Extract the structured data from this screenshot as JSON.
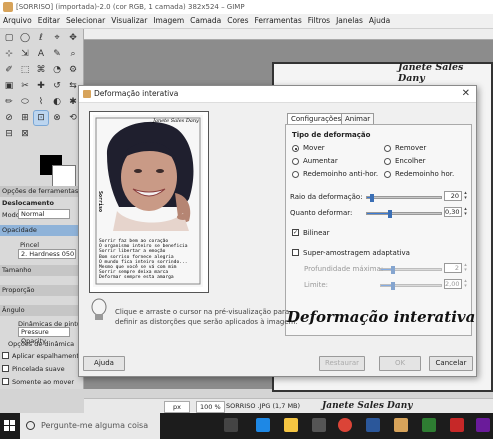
{
  "window": {
    "title": "[SORRISO] (importada)-2.0 (cor RGB, 1 camada) 382x524 – GIMP"
  },
  "menu": [
    "Arquivo",
    "Editar",
    "Selecionar",
    "Visualizar",
    "Imagem",
    "Camada",
    "Cores",
    "Ferramentas",
    "Filtros",
    "Janelas",
    "Ajuda"
  ],
  "toolbox": {
    "tool_options_header": "Opções de ferramentas",
    "tool_name": "Deslocamento",
    "mode_label": "Modo",
    "mode_value": "Normal",
    "opacity_label": "Opacidade",
    "brush_label": "Pincel",
    "brush_value": "2. Hardness 050",
    "size_label": "Tamanho",
    "ratio_label": "Proporção",
    "angle_label": "Ângulo",
    "dynamics_label": "Dinâmicas de pintura",
    "dynamics_value": "Pressure Opacity",
    "dynamics_options": "Opções de dinâmica",
    "apply_jitter": "Aplicar espalhamento",
    "smooth_stroke": "Pincelada suave",
    "only_move": "Somente ao mover"
  },
  "canvas": {
    "signature": "Janete Sales Dany"
  },
  "dialog": {
    "title": "Deformação interativa",
    "tabs": [
      "Configurações",
      "Animar"
    ],
    "deform_type_title": "Tipo de deformação",
    "modes": [
      {
        "label": "Mover",
        "selected": true
      },
      {
        "label": "Remover",
        "selected": false
      },
      {
        "label": "Aumentar",
        "selected": false
      },
      {
        "label": "Encolher",
        "selected": false
      },
      {
        "label": "Redemoinho anti-hor.",
        "selected": false
      },
      {
        "label": "Redemoinho hor.",
        "selected": false
      }
    ],
    "radius_label": "Raio da deformação:",
    "radius_value": "20",
    "radius_fraction": 0.06,
    "amount_label": "Quanto deformar:",
    "amount_value": "0,30",
    "amount_fraction": 0.3,
    "bilinear_label": "Bilinear",
    "bilinear_checked": true,
    "supersample_label": "Super-amostragem adaptativa",
    "supersample_checked": false,
    "max_depth_label": "Profundidade máxima:",
    "max_depth_value": "2",
    "max_depth_fraction": 0.2,
    "threshold_label": "Limite:",
    "threshold_value": "2,00",
    "threshold_fraction": 0.2,
    "hint_text_1": "Clique e arraste o cursor na pré-visualização para",
    "hint_text_2": "definir as distorções que serão aplicados à imagem.",
    "watermark": "Deformação interativa",
    "help_button": "Ajuda",
    "reset_button": "Restaurar",
    "ok_button": "OK",
    "cancel_button": "Cancelar",
    "preview": {
      "signature": "Janete Sales Dany",
      "vertical_word": "Sorriso",
      "poem": [
        "Sorrir faz bem ao coração",
        "O organismo inteiro se beneficia",
        "Sorrir libertar a emoção",
        "Bom sorriso fornece alegria",
        "O mundo fica inteiro sorrindo...",
        "Mesmo que você se vá com mim",
        "Sorrir sempre deixa marca",
        "Deformar sempre esta amarga"
      ]
    }
  },
  "statusbar": {
    "unit": "px",
    "zoom": "100 %",
    "file": "SORRISO .JPG (1,7 MB)"
  },
  "signature_bottom": "Janete Sales Dany",
  "taskbar": {
    "search_placeholder": "Pergunte-me alguma coisa"
  }
}
